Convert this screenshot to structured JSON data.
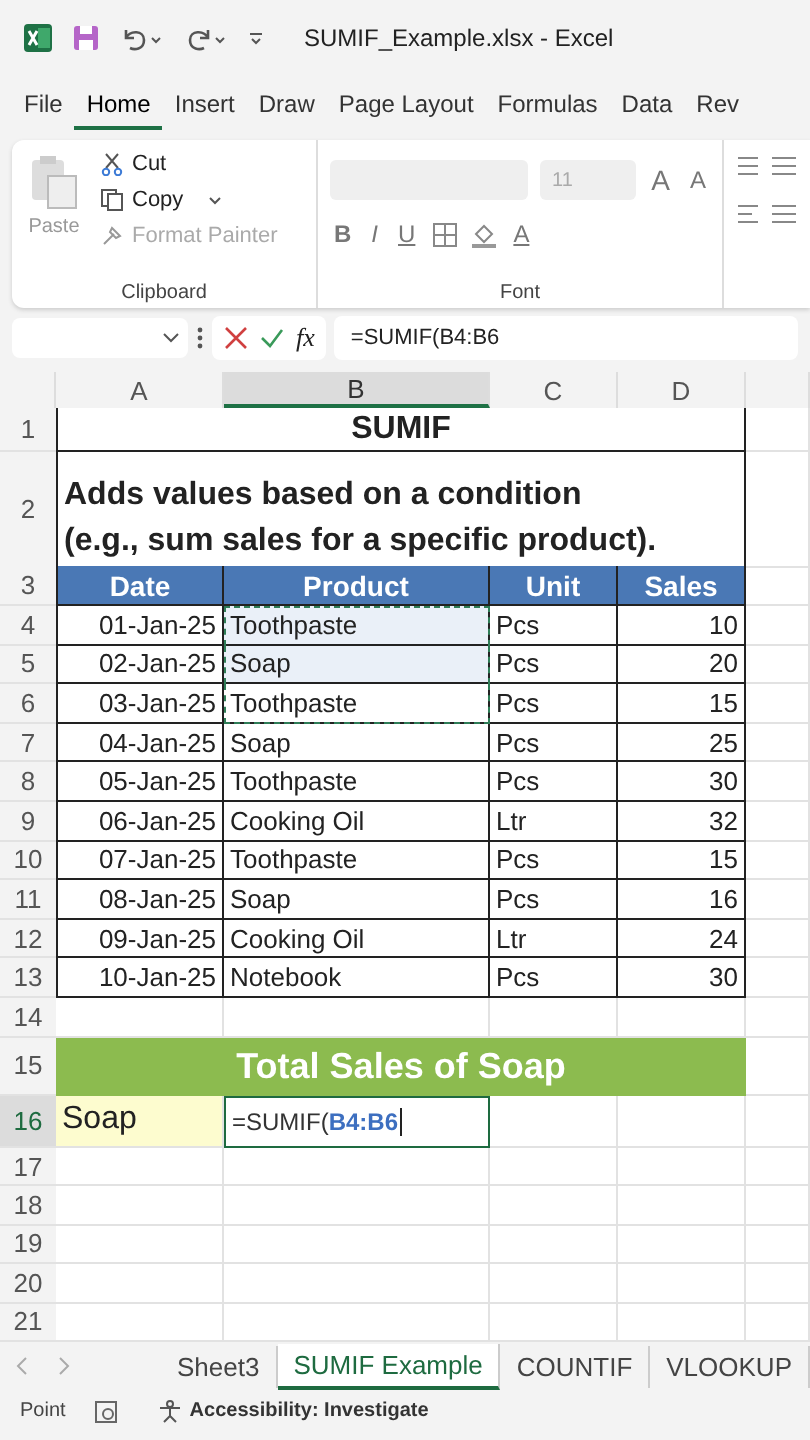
{
  "title_bar": {
    "title": "SUMIF_Example.xlsx  -  Excel"
  },
  "menu_tabs": [
    {
      "label": "File",
      "selected": false
    },
    {
      "label": "Home",
      "selected": true
    },
    {
      "label": "Insert",
      "selected": false
    },
    {
      "label": "Draw",
      "selected": false
    },
    {
      "label": "Page Layout",
      "selected": false
    },
    {
      "label": "Formulas",
      "selected": false
    },
    {
      "label": "Data",
      "selected": false
    },
    {
      "label": "Rev",
      "selected": false
    }
  ],
  "ribbon": {
    "clipboard": {
      "paste": "Paste",
      "cut": "Cut",
      "copy": "Copy",
      "format_painter": "Format Painter",
      "format_painter_disabled": true,
      "label": "Clipboard"
    },
    "font": {
      "size": "11",
      "grow": "A",
      "shrink": "A",
      "bold": "B",
      "italic": "I",
      "underline": "U",
      "font_color_button": "A",
      "label": "Font"
    }
  },
  "formula_bar": {
    "fx": "fx",
    "formula": "=SUMIF(B4:B6"
  },
  "columns": [
    {
      "label": "A",
      "selected": false
    },
    {
      "label": "B",
      "selected": true
    },
    {
      "label": "C",
      "selected": false
    },
    {
      "label": "D",
      "selected": false
    }
  ],
  "row_headers": [
    {
      "label": "1",
      "selected": false
    },
    {
      "label": "2",
      "selected": false
    },
    {
      "label": "3",
      "selected": false
    },
    {
      "label": "4",
      "selected": false
    },
    {
      "label": "5",
      "selected": false
    },
    {
      "label": "6",
      "selected": false
    },
    {
      "label": "7",
      "selected": false
    },
    {
      "label": "8",
      "selected": false
    },
    {
      "label": "9",
      "selected": false
    },
    {
      "label": "10",
      "selected": false
    },
    {
      "label": "11",
      "selected": false
    },
    {
      "label": "12",
      "selected": false
    },
    {
      "label": "13",
      "selected": false
    },
    {
      "label": "14",
      "selected": false
    },
    {
      "label": "15",
      "selected": false
    },
    {
      "label": "16",
      "selected": true
    },
    {
      "label": "17",
      "selected": false
    },
    {
      "label": "18",
      "selected": false
    },
    {
      "label": "19",
      "selected": false
    },
    {
      "label": "20",
      "selected": false
    },
    {
      "label": "21",
      "selected": false
    }
  ],
  "sheet": {
    "title": "SUMIF",
    "description_lines": [
      "Adds values based on a condition",
      "(e.g., sum sales for a specific product)."
    ],
    "headers": [
      "Date",
      "Product",
      "Unit",
      "Sales"
    ],
    "rows": [
      {
        "date": "01-Jan-25",
        "product": "Toothpaste",
        "unit": "Pcs",
        "sales": "10",
        "in_formula_range": true
      },
      {
        "date": "02-Jan-25",
        "product": "Soap",
        "unit": "Pcs",
        "sales": "20",
        "in_formula_range": true
      },
      {
        "date": "03-Jan-25",
        "product": "Toothpaste",
        "unit": "Pcs",
        "sales": "15",
        "in_formula_range": true
      },
      {
        "date": "04-Jan-25",
        "product": "Soap",
        "unit": "Pcs",
        "sales": "25",
        "in_formula_range": false
      },
      {
        "date": "05-Jan-25",
        "product": "Toothpaste",
        "unit": "Pcs",
        "sales": "30",
        "in_formula_range": false
      },
      {
        "date": "06-Jan-25",
        "product": "Cooking Oil",
        "unit": "Ltr",
        "sales": "32",
        "in_formula_range": false
      },
      {
        "date": "07-Jan-25",
        "product": "Toothpaste",
        "unit": "Pcs",
        "sales": "15",
        "in_formula_range": false
      },
      {
        "date": "08-Jan-25",
        "product": "Soap",
        "unit": "Pcs",
        "sales": "16",
        "in_formula_range": false
      },
      {
        "date": "09-Jan-25",
        "product": "Cooking Oil",
        "unit": "Ltr",
        "sales": "24",
        "in_formula_range": false
      },
      {
        "date": "10-Jan-25",
        "product": "Notebook",
        "unit": "Pcs",
        "sales": "30",
        "in_formula_range": false
      }
    ],
    "total_banner": "Total Sales of Soap",
    "criteria": "Soap",
    "editing_cell": {
      "function_part": "=SUMIF(",
      "reference_part": "B4:B6"
    }
  },
  "sheet_tabs": [
    {
      "label": "Sheet3",
      "selected": false
    },
    {
      "label": "SUMIF Example",
      "selected": true
    },
    {
      "label": "COUNTIF",
      "selected": false
    },
    {
      "label": "VLOOKUP",
      "selected": false
    }
  ],
  "status_bar": {
    "mode": "Point",
    "accessibility": "Accessibility: Investigate"
  }
}
